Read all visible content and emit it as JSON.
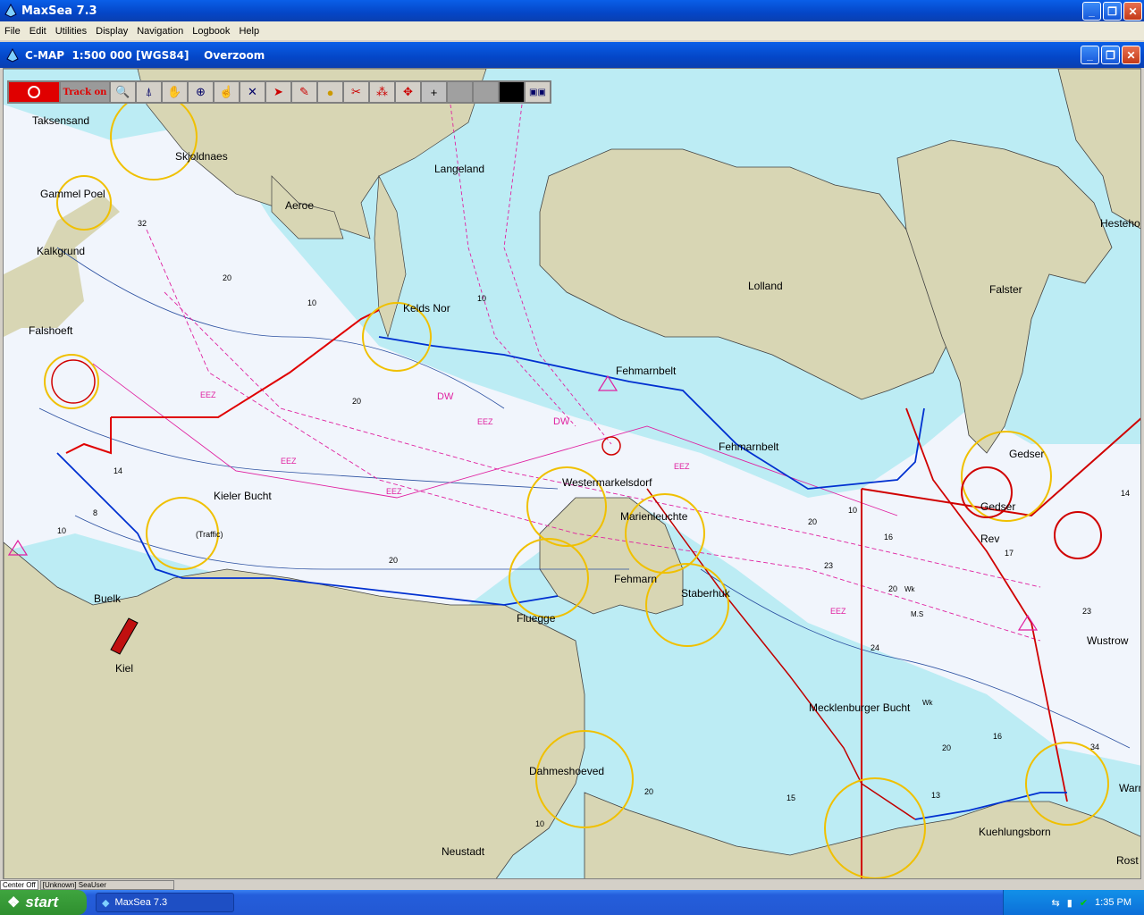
{
  "window": {
    "title": "MaxSea 7.3"
  },
  "menu": [
    "File",
    "Edit",
    "Utilities",
    "Display",
    "Navigation",
    "Logbook",
    "Help"
  ],
  "chart_window": {
    "title": "C-MAP  1:500 000 [WGS84]    Overzoom"
  },
  "toolbar": {
    "track_label": "Track on"
  },
  "map": {
    "places": {
      "taksensand": "Taksensand",
      "skjoldnaes": "Skjoldnaes",
      "langeland": "Langeland",
      "gammel_poel": "Gammel Poel",
      "aeroe": "Aeroe",
      "kalkgrund": "Kalkgrund",
      "lolland": "Lolland",
      "falster": "Falster",
      "hesteho": "Hesteho",
      "keldsnor": "Kelds Nor",
      "falshoeft": "Falshoeft",
      "fehmarnbelt1": "Fehmarnbelt",
      "fehmarnbelt2": "Fehmarnbelt",
      "gedser1": "Gedser",
      "gedser2": "Gedser",
      "rev": "Rev",
      "kieler_bucht": "Kieler Bucht",
      "traffic": "(Traffic)",
      "westermarkelsdorf": "Westermarkelsdorf",
      "marienleuchte": "Marienleuchte",
      "fehmarn": "Fehmarn",
      "staberhuk": "Staberhuk",
      "fluegge": "Fluegge",
      "buelk": "Buelk",
      "kiel": "Kiel",
      "wustrow": "Wustrow",
      "mecklenburger": "Mecklenburger Bucht",
      "dahmeshoeved": "Dahmeshoeved",
      "neustadt": "Neustadt",
      "kuehlungsborn": "Kuehlungsborn",
      "warn": "Warn",
      "rost": "Rost"
    },
    "soundings": [
      "32",
      "20",
      "10",
      "20",
      "14",
      "20",
      "10",
      "10",
      "16",
      "23",
      "24",
      "20",
      "15",
      "13",
      "16",
      "17",
      "34",
      "23",
      "14",
      "20",
      "20",
      "8",
      "10",
      "20",
      "10"
    ],
    "zones": [
      "EEZ",
      "EEZ",
      "EEZ",
      "EEZ",
      "EEZ",
      "EEZ",
      "DW",
      "DW"
    ],
    "marks": [
      "Wk",
      "Wk",
      "M.S"
    ]
  },
  "statusbar": {
    "cell1": "Center Off",
    "cell2": "[Unknown] SeaUser"
  },
  "taskbar": {
    "start": "start",
    "task": "MaxSea 7.3",
    "clock": "1:35 PM"
  }
}
